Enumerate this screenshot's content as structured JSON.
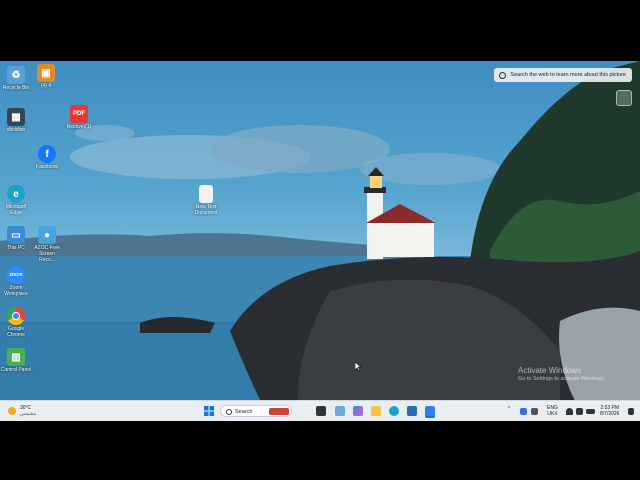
{
  "desktop": {
    "icons": [
      {
        "label": "Recycle Bin",
        "icon": "recycle-bin-icon",
        "color": "#5aa0d8"
      },
      {
        "label": "(4) 4",
        "icon": "package-icon",
        "color": "#e08a2a"
      },
      {
        "label": "obsidian",
        "icon": "image-file-icon",
        "color": "#334455"
      },
      {
        "label": "Recover(1)",
        "icon": "pdf-icon",
        "color": "#e53935"
      },
      {
        "label": "Facebook",
        "icon": "facebook-icon",
        "color": "#1877f2"
      },
      {
        "label": "Microsoft Edge",
        "icon": "edge-icon",
        "color": "#1fa0c8"
      },
      {
        "label": "New Text Document",
        "icon": "text-file-icon",
        "color": "#f2f2f2"
      },
      {
        "label": "This PC",
        "icon": "this-pc-icon",
        "color": "#3b8ad8"
      },
      {
        "label": "AZOC Free Screen Reco...",
        "icon": "screen-recorder-icon",
        "color": "#4aa3df"
      },
      {
        "label": "Zoom Workplace",
        "icon": "zoom-icon",
        "color": "#2d8cff"
      },
      {
        "label": "Google Chrome",
        "icon": "chrome-icon",
        "color": "#34a853"
      },
      {
        "label": "Control Panel",
        "icon": "control-panel-icon",
        "color": "#4caf50"
      }
    ]
  },
  "search_tip": "Search the web to learn more about this picture",
  "activation": {
    "title": "Activate Windows",
    "subtitle": "Go to Settings to activate Windows."
  },
  "taskbar": {
    "weather_temp": "30°C",
    "weather_desc": "مشمس",
    "search_placeholder": "Search",
    "lang_top": "ENG",
    "lang_bottom": "UKX",
    "time": "2:53 PM",
    "date": "8/7/2026"
  }
}
